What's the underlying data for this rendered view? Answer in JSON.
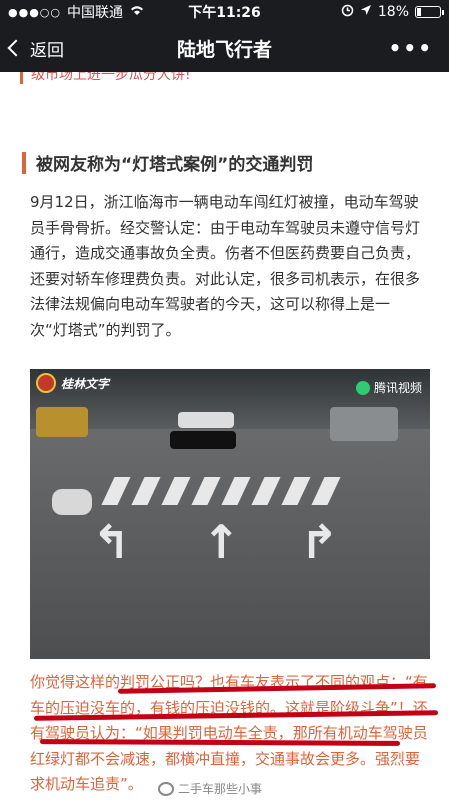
{
  "status_bar": {
    "signal": "●●●○○",
    "carrier": "中国联通",
    "time": "下午11:26",
    "battery_text": "18%",
    "battery_level": 0.18
  },
  "nav": {
    "back_label": "返回",
    "title": "陆地飞行者",
    "more_label": "•••"
  },
  "article": {
    "previous_fragment": "级市场上进一步瓜分大饼!",
    "section_title": "被网友称为“灯塔式案例”的交通判罚",
    "paragraph": "9月12日，浙江临海市一辆电动车闯红灯被撞，电动车驾驶员手骨骨折。经交警认定：由于电动车驾驶员未遵守信号灯通行，造成交通事故负全责。伤者不但医药费要自己负责，还要对轿车修理费负责。对此认定，很多司机表示，在很多法律法规偏向电动车驾驶者的今天，这可以称得上是一次“灯塔式”的判罚了。",
    "video": {
      "logo_text": "桂林文字",
      "watermark": "腾讯视频"
    },
    "quote_paragraph": "你觉得这样的判罚公正吗？也有车友表示了不同的观点：“有车的压迫没车的，有钱的压迫没钱的。这就是阶级斗争”！还有驾驶员认为：“如果判罚电动车全责，那所有机动车驾驶员红绿灯都不会减速，都横冲直撞，交通事故会更多。强烈要求机动车追责”。"
  },
  "weibo_watermark": "二手车那些小事",
  "colors": {
    "accent": "#e0633a",
    "underline": "#c40017",
    "nav_bg": "#1b1c1f"
  }
}
